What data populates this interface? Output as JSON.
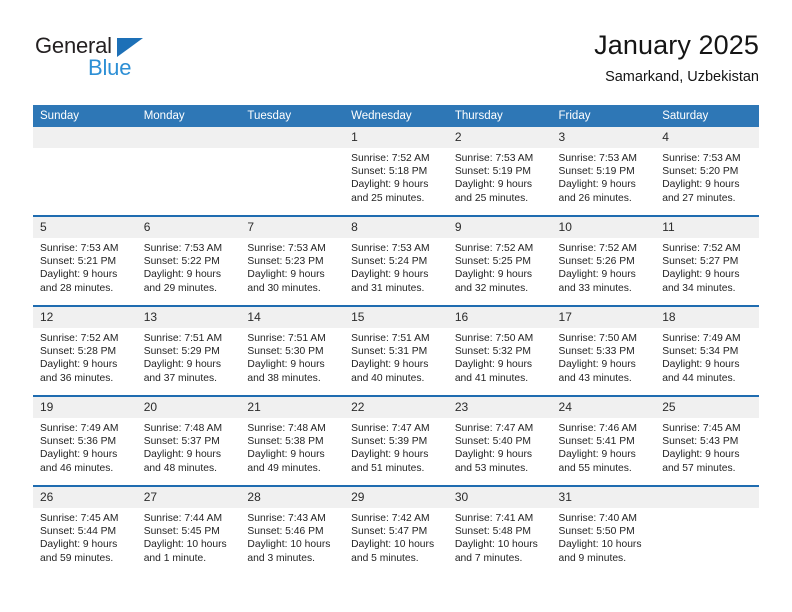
{
  "brand": {
    "name_top": "General",
    "name_bottom": "Blue",
    "triangle_icon": "triangle-icon",
    "accent_dark": "#1d70b7",
    "accent_light": "#2d8fd5"
  },
  "header": {
    "title": "January 2025",
    "subtitle": "Samarkand, Uzbekistan"
  },
  "theme": {
    "header_blue": "#2e77b6",
    "separator_blue": "#1f6cb0",
    "day_band_gray": "#f0f0f0"
  },
  "calendar": {
    "weekday_headers": [
      "Sunday",
      "Monday",
      "Tuesday",
      "Wednesday",
      "Thursday",
      "Friday",
      "Saturday"
    ],
    "weeks": [
      [
        {
          "day": "",
          "lines": []
        },
        {
          "day": "",
          "lines": []
        },
        {
          "day": "",
          "lines": []
        },
        {
          "day": "1",
          "lines": [
            "Sunrise: 7:52 AM",
            "Sunset: 5:18 PM",
            "Daylight: 9 hours",
            "and 25 minutes."
          ]
        },
        {
          "day": "2",
          "lines": [
            "Sunrise: 7:53 AM",
            "Sunset: 5:19 PM",
            "Daylight: 9 hours",
            "and 25 minutes."
          ]
        },
        {
          "day": "3",
          "lines": [
            "Sunrise: 7:53 AM",
            "Sunset: 5:19 PM",
            "Daylight: 9 hours",
            "and 26 minutes."
          ]
        },
        {
          "day": "4",
          "lines": [
            "Sunrise: 7:53 AM",
            "Sunset: 5:20 PM",
            "Daylight: 9 hours",
            "and 27 minutes."
          ]
        }
      ],
      [
        {
          "day": "5",
          "lines": [
            "Sunrise: 7:53 AM",
            "Sunset: 5:21 PM",
            "Daylight: 9 hours",
            "and 28 minutes."
          ]
        },
        {
          "day": "6",
          "lines": [
            "Sunrise: 7:53 AM",
            "Sunset: 5:22 PM",
            "Daylight: 9 hours",
            "and 29 minutes."
          ]
        },
        {
          "day": "7",
          "lines": [
            "Sunrise: 7:53 AM",
            "Sunset: 5:23 PM",
            "Daylight: 9 hours",
            "and 30 minutes."
          ]
        },
        {
          "day": "8",
          "lines": [
            "Sunrise: 7:53 AM",
            "Sunset: 5:24 PM",
            "Daylight: 9 hours",
            "and 31 minutes."
          ]
        },
        {
          "day": "9",
          "lines": [
            "Sunrise: 7:52 AM",
            "Sunset: 5:25 PM",
            "Daylight: 9 hours",
            "and 32 minutes."
          ]
        },
        {
          "day": "10",
          "lines": [
            "Sunrise: 7:52 AM",
            "Sunset: 5:26 PM",
            "Daylight: 9 hours",
            "and 33 minutes."
          ]
        },
        {
          "day": "11",
          "lines": [
            "Sunrise: 7:52 AM",
            "Sunset: 5:27 PM",
            "Daylight: 9 hours",
            "and 34 minutes."
          ]
        }
      ],
      [
        {
          "day": "12",
          "lines": [
            "Sunrise: 7:52 AM",
            "Sunset: 5:28 PM",
            "Daylight: 9 hours",
            "and 36 minutes."
          ]
        },
        {
          "day": "13",
          "lines": [
            "Sunrise: 7:51 AM",
            "Sunset: 5:29 PM",
            "Daylight: 9 hours",
            "and 37 minutes."
          ]
        },
        {
          "day": "14",
          "lines": [
            "Sunrise: 7:51 AM",
            "Sunset: 5:30 PM",
            "Daylight: 9 hours",
            "and 38 minutes."
          ]
        },
        {
          "day": "15",
          "lines": [
            "Sunrise: 7:51 AM",
            "Sunset: 5:31 PM",
            "Daylight: 9 hours",
            "and 40 minutes."
          ]
        },
        {
          "day": "16",
          "lines": [
            "Sunrise: 7:50 AM",
            "Sunset: 5:32 PM",
            "Daylight: 9 hours",
            "and 41 minutes."
          ]
        },
        {
          "day": "17",
          "lines": [
            "Sunrise: 7:50 AM",
            "Sunset: 5:33 PM",
            "Daylight: 9 hours",
            "and 43 minutes."
          ]
        },
        {
          "day": "18",
          "lines": [
            "Sunrise: 7:49 AM",
            "Sunset: 5:34 PM",
            "Daylight: 9 hours",
            "and 44 minutes."
          ]
        }
      ],
      [
        {
          "day": "19",
          "lines": [
            "Sunrise: 7:49 AM",
            "Sunset: 5:36 PM",
            "Daylight: 9 hours",
            "and 46 minutes."
          ]
        },
        {
          "day": "20",
          "lines": [
            "Sunrise: 7:48 AM",
            "Sunset: 5:37 PM",
            "Daylight: 9 hours",
            "and 48 minutes."
          ]
        },
        {
          "day": "21",
          "lines": [
            "Sunrise: 7:48 AM",
            "Sunset: 5:38 PM",
            "Daylight: 9 hours",
            "and 49 minutes."
          ]
        },
        {
          "day": "22",
          "lines": [
            "Sunrise: 7:47 AM",
            "Sunset: 5:39 PM",
            "Daylight: 9 hours",
            "and 51 minutes."
          ]
        },
        {
          "day": "23",
          "lines": [
            "Sunrise: 7:47 AM",
            "Sunset: 5:40 PM",
            "Daylight: 9 hours",
            "and 53 minutes."
          ]
        },
        {
          "day": "24",
          "lines": [
            "Sunrise: 7:46 AM",
            "Sunset: 5:41 PM",
            "Daylight: 9 hours",
            "and 55 minutes."
          ]
        },
        {
          "day": "25",
          "lines": [
            "Sunrise: 7:45 AM",
            "Sunset: 5:43 PM",
            "Daylight: 9 hours",
            "and 57 minutes."
          ]
        }
      ],
      [
        {
          "day": "26",
          "lines": [
            "Sunrise: 7:45 AM",
            "Sunset: 5:44 PM",
            "Daylight: 9 hours",
            "and 59 minutes."
          ]
        },
        {
          "day": "27",
          "lines": [
            "Sunrise: 7:44 AM",
            "Sunset: 5:45 PM",
            "Daylight: 10 hours",
            "and 1 minute."
          ]
        },
        {
          "day": "28",
          "lines": [
            "Sunrise: 7:43 AM",
            "Sunset: 5:46 PM",
            "Daylight: 10 hours",
            "and 3 minutes."
          ]
        },
        {
          "day": "29",
          "lines": [
            "Sunrise: 7:42 AM",
            "Sunset: 5:47 PM",
            "Daylight: 10 hours",
            "and 5 minutes."
          ]
        },
        {
          "day": "30",
          "lines": [
            "Sunrise: 7:41 AM",
            "Sunset: 5:48 PM",
            "Daylight: 10 hours",
            "and 7 minutes."
          ]
        },
        {
          "day": "31",
          "lines": [
            "Sunrise: 7:40 AM",
            "Sunset: 5:50 PM",
            "Daylight: 10 hours",
            "and 9 minutes."
          ]
        },
        {
          "day": "",
          "lines": []
        }
      ]
    ]
  }
}
